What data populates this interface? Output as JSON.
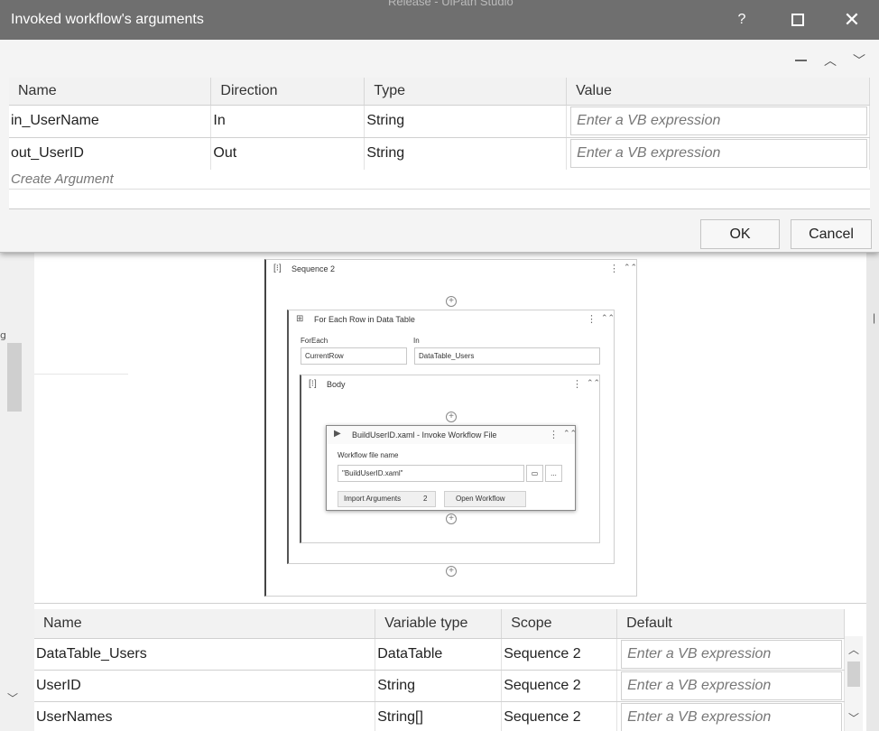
{
  "window": {
    "app_title_hint": "Release - UiPath Studio"
  },
  "dialog": {
    "title": "Invoked workflow's arguments",
    "help": "?",
    "close": "✕",
    "columns": [
      "Name",
      "Direction",
      "Type",
      "Value"
    ],
    "rows": [
      {
        "name": "in_UserName",
        "direction": "In",
        "type": "String",
        "value_placeholder": "Enter a VB expression"
      },
      {
        "name": "out_UserID",
        "direction": "Out",
        "type": "String",
        "value_placeholder": "Enter a VB expression"
      }
    ],
    "create_argument": "Create Argument",
    "ok": "OK",
    "cancel": "Cancel"
  },
  "designer": {
    "sequence": {
      "title": "Sequence 2"
    },
    "for_each": {
      "title": "For Each Row in Data Table",
      "foreach_label": "ForEach",
      "in_label": "In",
      "foreach_value": "CurrentRow",
      "in_value": "DataTable_Users"
    },
    "body": {
      "title": "Body"
    },
    "invoke": {
      "title": "BuildUserID.xaml - Invoke Workflow File",
      "file_label": "Workflow file name",
      "file_value": "\"BuildUserID.xaml\"",
      "browse_more": "...",
      "import_label": "Import Arguments",
      "import_count": "2",
      "open_label": "Open Workflow"
    }
  },
  "variables": {
    "columns": [
      "Name",
      "Variable type",
      "Scope",
      "Default"
    ],
    "rows": [
      {
        "name": "DataTable_Users",
        "type": "DataTable",
        "scope": "Sequence 2",
        "default_placeholder": "Enter a VB expression"
      },
      {
        "name": "UserID",
        "type": "String",
        "scope": "Sequence 2",
        "default_placeholder": "Enter a VB expression"
      },
      {
        "name": "UserNames",
        "type": "String[]",
        "scope": "Sequence 2",
        "default_placeholder": "Enter a VB expression"
      }
    ]
  },
  "icons": [
    "help-icon",
    "maximize-icon",
    "close-icon",
    "minimize-icon",
    "chevron-up-icon",
    "chevron-down-icon",
    "sequence-icon",
    "for-each-icon",
    "invoke-play-icon",
    "folder-icon",
    "more-options-icon",
    "collapse-icon",
    "add-activity-icon"
  ]
}
